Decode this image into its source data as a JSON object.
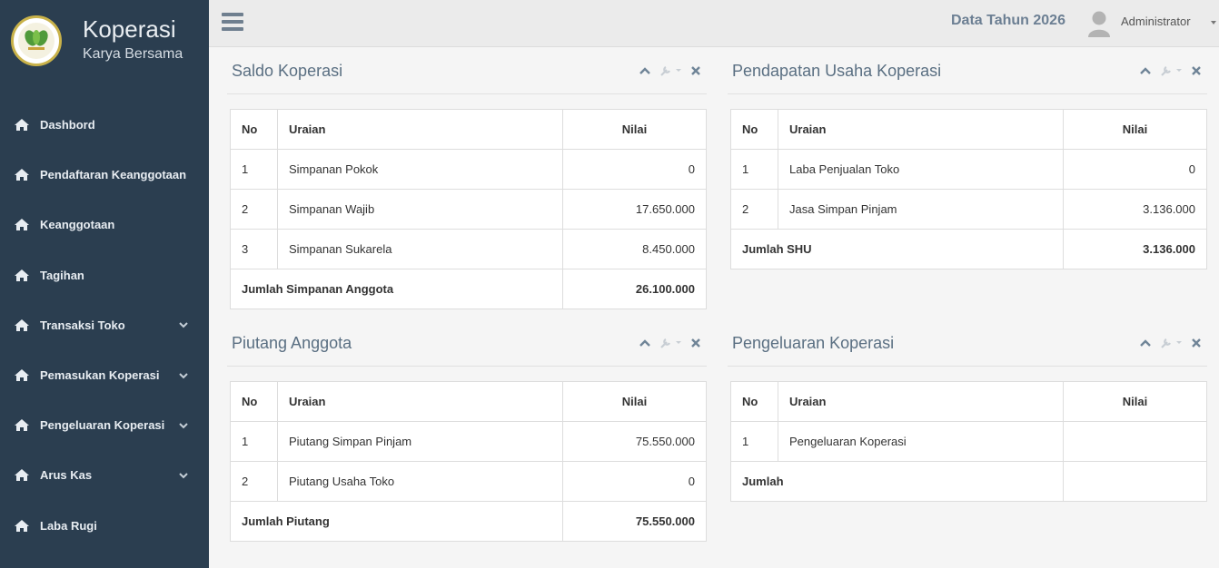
{
  "brand": {
    "title": "Koperasi",
    "subtitle": "Karya Bersama"
  },
  "menu": [
    {
      "label": "Dashbord",
      "has_children": false
    },
    {
      "label": "Pendaftaran Keanggotaan",
      "has_children": false
    },
    {
      "label": "Keanggotaan",
      "has_children": false
    },
    {
      "label": "Tagihan",
      "has_children": false
    },
    {
      "label": "Transaksi Toko",
      "has_children": true
    },
    {
      "label": "Pemasukan Koperasi",
      "has_children": true
    },
    {
      "label": "Pengeluaran Koperasi",
      "has_children": true
    },
    {
      "label": "Arus Kas",
      "has_children": true
    },
    {
      "label": "Laba Rugi",
      "has_children": false
    }
  ],
  "topbar": {
    "data_year": "Data Tahun 2026",
    "user": "Administrator"
  },
  "colors": {
    "sidebar": "#2b3e50",
    "title": "#5a6f82",
    "accent_year": "#6c7f93"
  },
  "icons": {
    "menu": "home-icon",
    "toggle": "hamburger-icon",
    "collapse": "chevron-up-icon",
    "settings": "wrench-icon",
    "close": "close-icon"
  },
  "widgets": {
    "saldo": {
      "title": "Saldo Koperasi",
      "headers": {
        "no": "No",
        "uraian": "Uraian",
        "nilai": "Nilai"
      },
      "rows": [
        {
          "no": "1",
          "uraian": "Simpanan Pokok",
          "nilai": "0"
        },
        {
          "no": "2",
          "uraian": "Simpanan Wajib",
          "nilai": "17.650.000"
        },
        {
          "no": "3",
          "uraian": "Simpanan Sukarela",
          "nilai": "8.450.000"
        }
      ],
      "total_label": "Jumlah Simpanan Anggota",
      "total_value": "26.100.000"
    },
    "pendapatan": {
      "title": "Pendapatan Usaha Koperasi",
      "headers": {
        "no": "No",
        "uraian": "Uraian",
        "nilai": "Nilai"
      },
      "rows": [
        {
          "no": "1",
          "uraian": "Laba Penjualan Toko",
          "nilai": "0"
        },
        {
          "no": "2",
          "uraian": "Jasa Simpan Pinjam",
          "nilai": "3.136.000"
        }
      ],
      "total_label": "Jumlah SHU",
      "total_value": "3.136.000"
    },
    "piutang": {
      "title": "Piutang Anggota",
      "headers": {
        "no": "No",
        "uraian": "Uraian",
        "nilai": "Nilai"
      },
      "rows": [
        {
          "no": "1",
          "uraian": "Piutang Simpan Pinjam",
          "nilai": "75.550.000"
        },
        {
          "no": "2",
          "uraian": "Piutang Usaha Toko",
          "nilai": "0"
        }
      ],
      "total_label": "Jumlah Piutang",
      "total_value": "75.550.000"
    },
    "pengeluaran": {
      "title": "Pengeluaran Koperasi",
      "headers": {
        "no": "No",
        "uraian": "Uraian",
        "nilai": "Nilai"
      },
      "rows": [
        {
          "no": "1",
          "uraian": "Pengeluaran Koperasi",
          "nilai": ""
        }
      ],
      "total_label": "Jumlah",
      "total_value": ""
    }
  }
}
